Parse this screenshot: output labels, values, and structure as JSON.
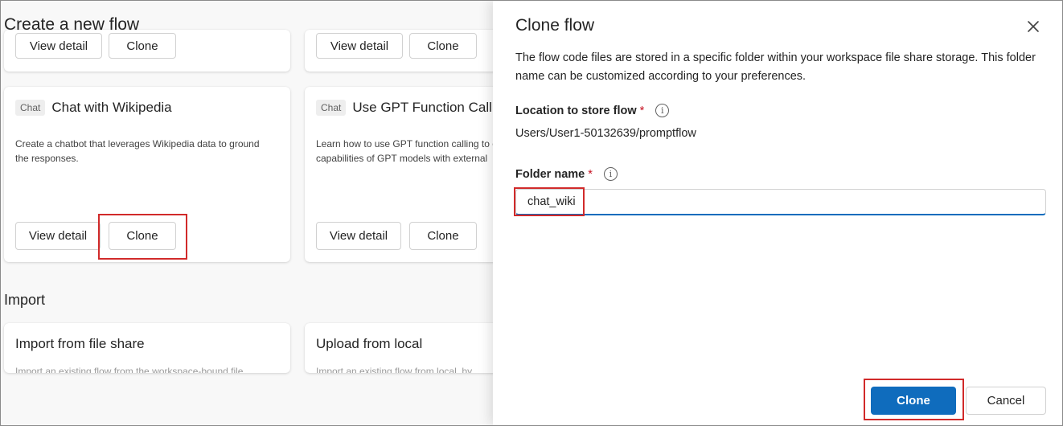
{
  "left_page": {
    "title": "Create a new flow",
    "top_cards": [
      {
        "view_detail_label": "View detail",
        "clone_label": "Clone"
      },
      {
        "view_detail_label": "View detail",
        "clone_label": "Clone"
      }
    ],
    "cards": [
      {
        "chip": "Chat",
        "title": "Chat with Wikipedia",
        "description": "Create a chatbot that leverages Wikipedia data to ground the responses.",
        "view_detail_label": "View detail",
        "clone_label": "Clone"
      },
      {
        "chip": "Chat",
        "title": "Use GPT Function Calling",
        "description": "Learn how to use GPT function calling to extend the capabilities of GPT models with external",
        "view_detail_label": "View detail",
        "clone_label": "Clone"
      }
    ],
    "import_section": {
      "title": "Import",
      "cards": [
        {
          "title": "Import from file share",
          "description": "Import an existing flow from the workspace-bound file"
        },
        {
          "title": "Upload from local",
          "description": "Import an existing flow from local, by"
        }
      ]
    }
  },
  "panel": {
    "title": "Clone flow",
    "description": "The flow code files are stored in a specific folder within your workspace file share storage. This folder name can be customized according to your preferences.",
    "location": {
      "label": "Location to store flow",
      "required_marker": "*",
      "info_glyph": "i",
      "value": "Users/User1-50132639/promptflow"
    },
    "folder": {
      "label": "Folder name",
      "required_marker": "*",
      "info_glyph": "i",
      "value": "chat_wiki"
    },
    "primary_button": "Clone",
    "secondary_button": "Cancel",
    "close_icon": "close-icon"
  },
  "colors": {
    "accent": "#0f6cbd",
    "required": "#c50f1f",
    "highlight": "#d12a2a"
  }
}
